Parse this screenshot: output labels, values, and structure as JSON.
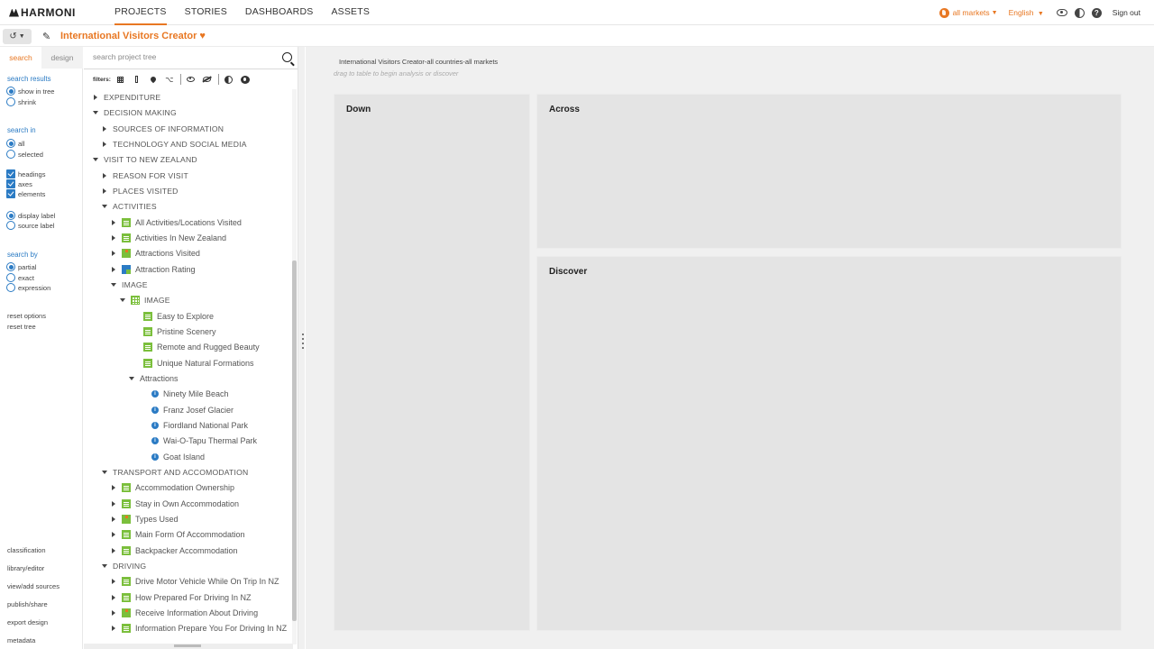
{
  "nav": {
    "logo": "HARMONI",
    "links": [
      "PROJECTS",
      "STORIES",
      "DASHBOARDS",
      "ASSETS"
    ],
    "active_link": "PROJECTS",
    "markets": "all markets",
    "language": "English",
    "signout": "Sign out"
  },
  "toolbar": {
    "history_icon": "history-icon",
    "project_title": "International Visitors Creator",
    "favorite_icon": "heart-icon"
  },
  "left_panel": {
    "tabs": [
      "search",
      "design"
    ],
    "search_results_heading": "search results",
    "search_results_options": [
      "show in tree",
      "shrink"
    ],
    "search_in_heading": "search in",
    "search_in_options": [
      "all",
      "selected"
    ],
    "search_in_checks": [
      "headings",
      "axes",
      "elements"
    ],
    "label_options": [
      "display label",
      "source label"
    ],
    "search_by_heading": "search by",
    "search_by_options": [
      "partial",
      "exact",
      "expression"
    ],
    "reset_links": [
      "reset options",
      "reset tree"
    ],
    "bottom_links": [
      "classification",
      "library/editor",
      "view/add sources",
      "publish/share",
      "export design",
      "metadata"
    ]
  },
  "tree_panel": {
    "search_placeholder": "search project tree",
    "filters_label": "filters:",
    "nodes": [
      {
        "label": "EXPENDITURE"
      },
      {
        "label": "DECISION MAKING"
      },
      {
        "label": "SOURCES OF INFORMATION"
      },
      {
        "label": "TECHNOLOGY AND SOCIAL MEDIA"
      },
      {
        "label": "VISIT TO NEW ZEALAND"
      },
      {
        "label": "REASON FOR VISIT"
      },
      {
        "label": "PLACES VISITED"
      },
      {
        "label": "ACTIVITIES"
      },
      {
        "label": "All Activities/Locations Visited"
      },
      {
        "label": "Activities In New Zealand"
      },
      {
        "label": "Attractions Visited"
      },
      {
        "label": "Attraction Rating"
      },
      {
        "label": "IMAGE"
      },
      {
        "label": "IMAGE"
      },
      {
        "label": "Easy to Explore"
      },
      {
        "label": "Pristine Scenery"
      },
      {
        "label": "Remote and Rugged Beauty"
      },
      {
        "label": "Unique Natural Formations"
      },
      {
        "label": "Attractions"
      },
      {
        "label": "Ninety Mile Beach"
      },
      {
        "label": "Franz Josef Glacier"
      },
      {
        "label": "Fiordland National Park"
      },
      {
        "label": "Wai-O-Tapu Thermal Park"
      },
      {
        "label": "Goat Island"
      },
      {
        "label": "TRANSPORT AND ACCOMODATION"
      },
      {
        "label": "Accommodation Ownership"
      },
      {
        "label": "Stay in Own Accommodation"
      },
      {
        "label": "Types Used"
      },
      {
        "label": "Main Form Of Accommodation"
      },
      {
        "label": "Backpacker Accommodation"
      },
      {
        "label": "DRIVING"
      },
      {
        "label": "Drive Motor Vehicle While On Trip In NZ"
      },
      {
        "label": "How Prepared For Driving In NZ"
      },
      {
        "label": "Receive Information About Driving"
      },
      {
        "label": "Information Prepare You For Driving In NZ"
      }
    ]
  },
  "workspace": {
    "title": "International Visitors Creator-all countries-all markets",
    "hint": "drag to table to begin analysis or discover",
    "zones": [
      "Down",
      "Across",
      "Discover"
    ]
  },
  "colors": {
    "accent": "#e87722",
    "link_blue": "#2b7bc4",
    "variable_green": "#7bbf3c",
    "zone_gray": "#e4e4e4"
  }
}
